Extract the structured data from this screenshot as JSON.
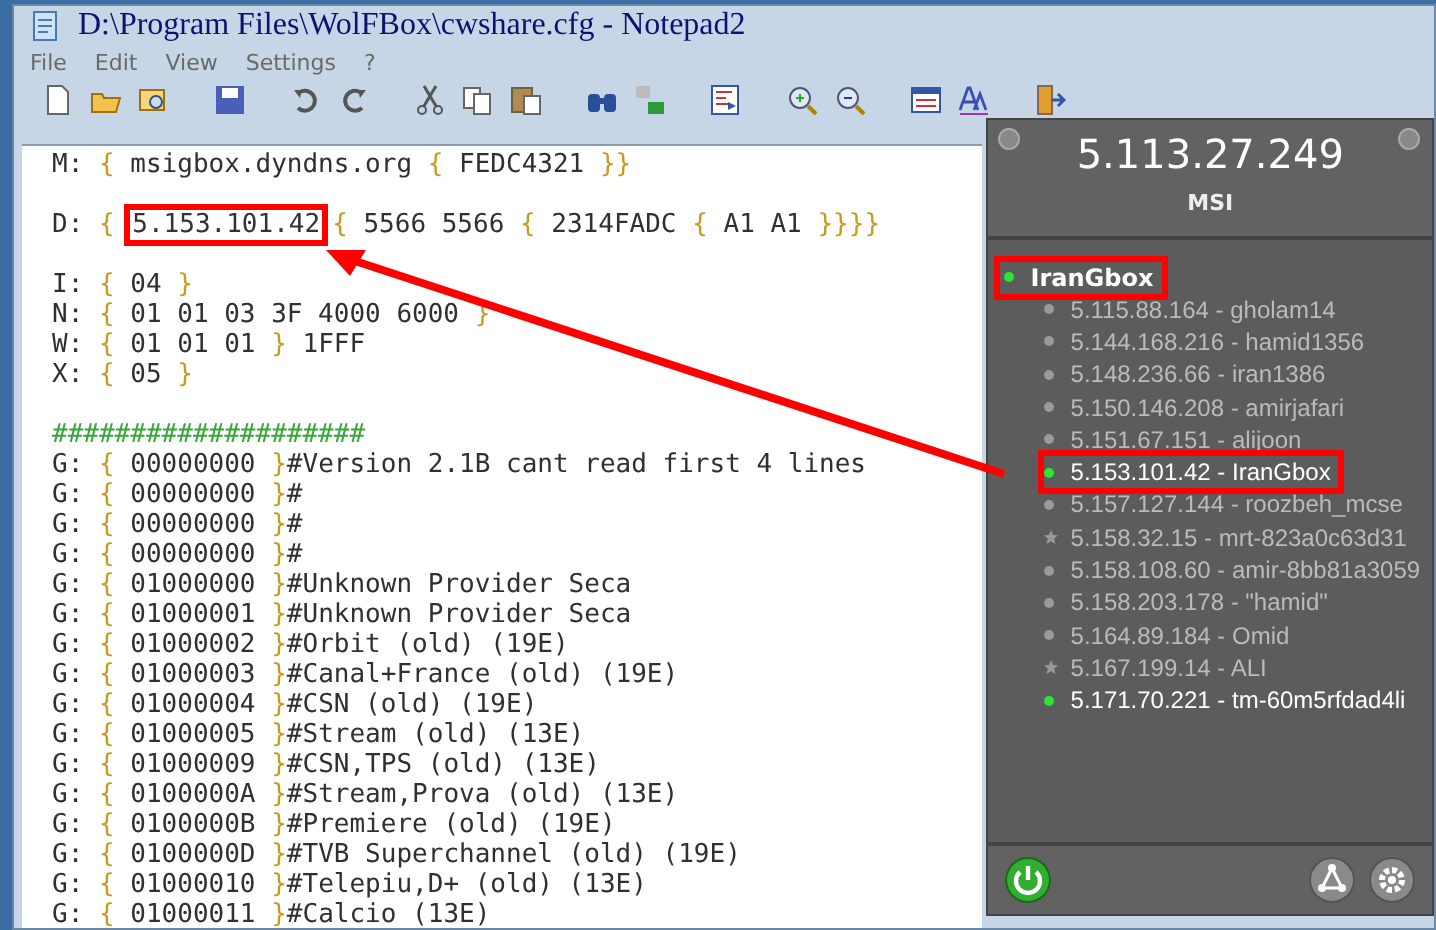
{
  "window": {
    "title": "D:\\Program Files\\WolFBox\\cwshare.cfg - Notepad2"
  },
  "menu": [
    "File",
    "Edit",
    "View",
    "Settings",
    "?"
  ],
  "toolbar": [
    {
      "kind": "new"
    },
    {
      "kind": "open"
    },
    {
      "kind": "browse"
    },
    {
      "kind": "save"
    },
    {
      "kind": "undo"
    },
    {
      "kind": "redo"
    },
    {
      "kind": "cut"
    },
    {
      "kind": "copy"
    },
    {
      "kind": "paste"
    },
    {
      "kind": "find"
    },
    {
      "kind": "replace"
    },
    {
      "kind": "goto"
    },
    {
      "kind": "zoomin"
    },
    {
      "kind": "zoomout"
    },
    {
      "kind": "scheme"
    },
    {
      "kind": "font"
    },
    {
      "kind": "exit"
    }
  ],
  "editor": {
    "blocks": [
      [
        "M: { msigbox.dyndns.org { FEDC4321 }}"
      ],
      [
        {
          "before": "D: { ",
          "boxed": "5.153.101.42",
          "after": "{ 5566 5566 { 2314FADC { A1 A1 }}}}"
        }
      ],
      [
        "I: { 04 }",
        "N: { 01 01 03 3F 4000 6000 }",
        "W: { 01 01 01 } 1FFF",
        "X: { 05 }"
      ],
      [
        "####################",
        "G: { 00000000 }#Version 2.1B cant read first 4 lines",
        "G: { 00000000 }#",
        "G: { 00000000 }#",
        "G: { 00000000 }#",
        "G: { 01000000 }#Unknown Provider Seca",
        "G: { 01000001 }#Unknown Provider Seca",
        "G: { 01000002 }#Orbit (old) (19E)",
        "G: { 01000003 }#Canal+France (old) (19E)",
        "G: { 01000004 }#CSN (old) (19E)",
        "G: { 01000005 }#Stream (old) (13E)",
        "G: { 01000009 }#CSN,TPS (old) (13E)",
        "G: { 0100000A }#Stream,Prova (old) (13E)",
        "G: { 0100000B }#Premiere (old) (19E)",
        "G: { 0100000D }#TVB Superchannel (old) (19E)",
        "G: { 01000010 }#Telepiu,D+ (old) (13E)",
        "G: { 01000011 }#Calcio (13E)"
      ]
    ]
  },
  "panel": {
    "address": "5.113.27.249",
    "name": "MSI",
    "group": {
      "label": "IranGbox",
      "online": true,
      "highlighted": true
    },
    "peers": [
      {
        "label": "5.115.88.164 - gholam14",
        "kind": "dot",
        "online": false,
        "highlighted": false
      },
      {
        "label": "5.144.168.216 - hamid1356",
        "kind": "dot",
        "online": false,
        "highlighted": false
      },
      {
        "label": "5.148.236.66 - iran1386",
        "kind": "dot",
        "online": false,
        "highlighted": false
      },
      {
        "label": "5.150.146.208 - amirjafari",
        "kind": "dot",
        "online": false,
        "highlighted": false
      },
      {
        "label": "5.151.67.151 - alijoon",
        "kind": "dot",
        "online": false,
        "highlighted": false
      },
      {
        "label": "5.153.101.42 - IranGbox",
        "kind": "dot",
        "online": true,
        "highlighted": true
      },
      {
        "label": "5.157.127.144 - roozbeh_mcse",
        "kind": "dot",
        "online": false,
        "highlighted": false
      },
      {
        "label": "5.158.32.15 - mrt-823a0c63d31",
        "kind": "star",
        "online": false,
        "highlighted": false
      },
      {
        "label": "5.158.108.60 - amir-8bb81a3059",
        "kind": "dot",
        "online": false,
        "highlighted": false
      },
      {
        "label": "5.158.203.178 - \"hamid\"",
        "kind": "dot",
        "online": false,
        "highlighted": false
      },
      {
        "label": "5.164.89.184 - Omid",
        "kind": "dot",
        "online": false,
        "highlighted": false
      },
      {
        "label": "5.167.199.14 - ALI",
        "kind": "star",
        "online": false,
        "highlighted": false
      },
      {
        "label": "5.171.70.221 - tm-60m5rfdad4li",
        "kind": "dot",
        "online": true,
        "highlighted": false
      }
    ]
  },
  "arrow": true
}
